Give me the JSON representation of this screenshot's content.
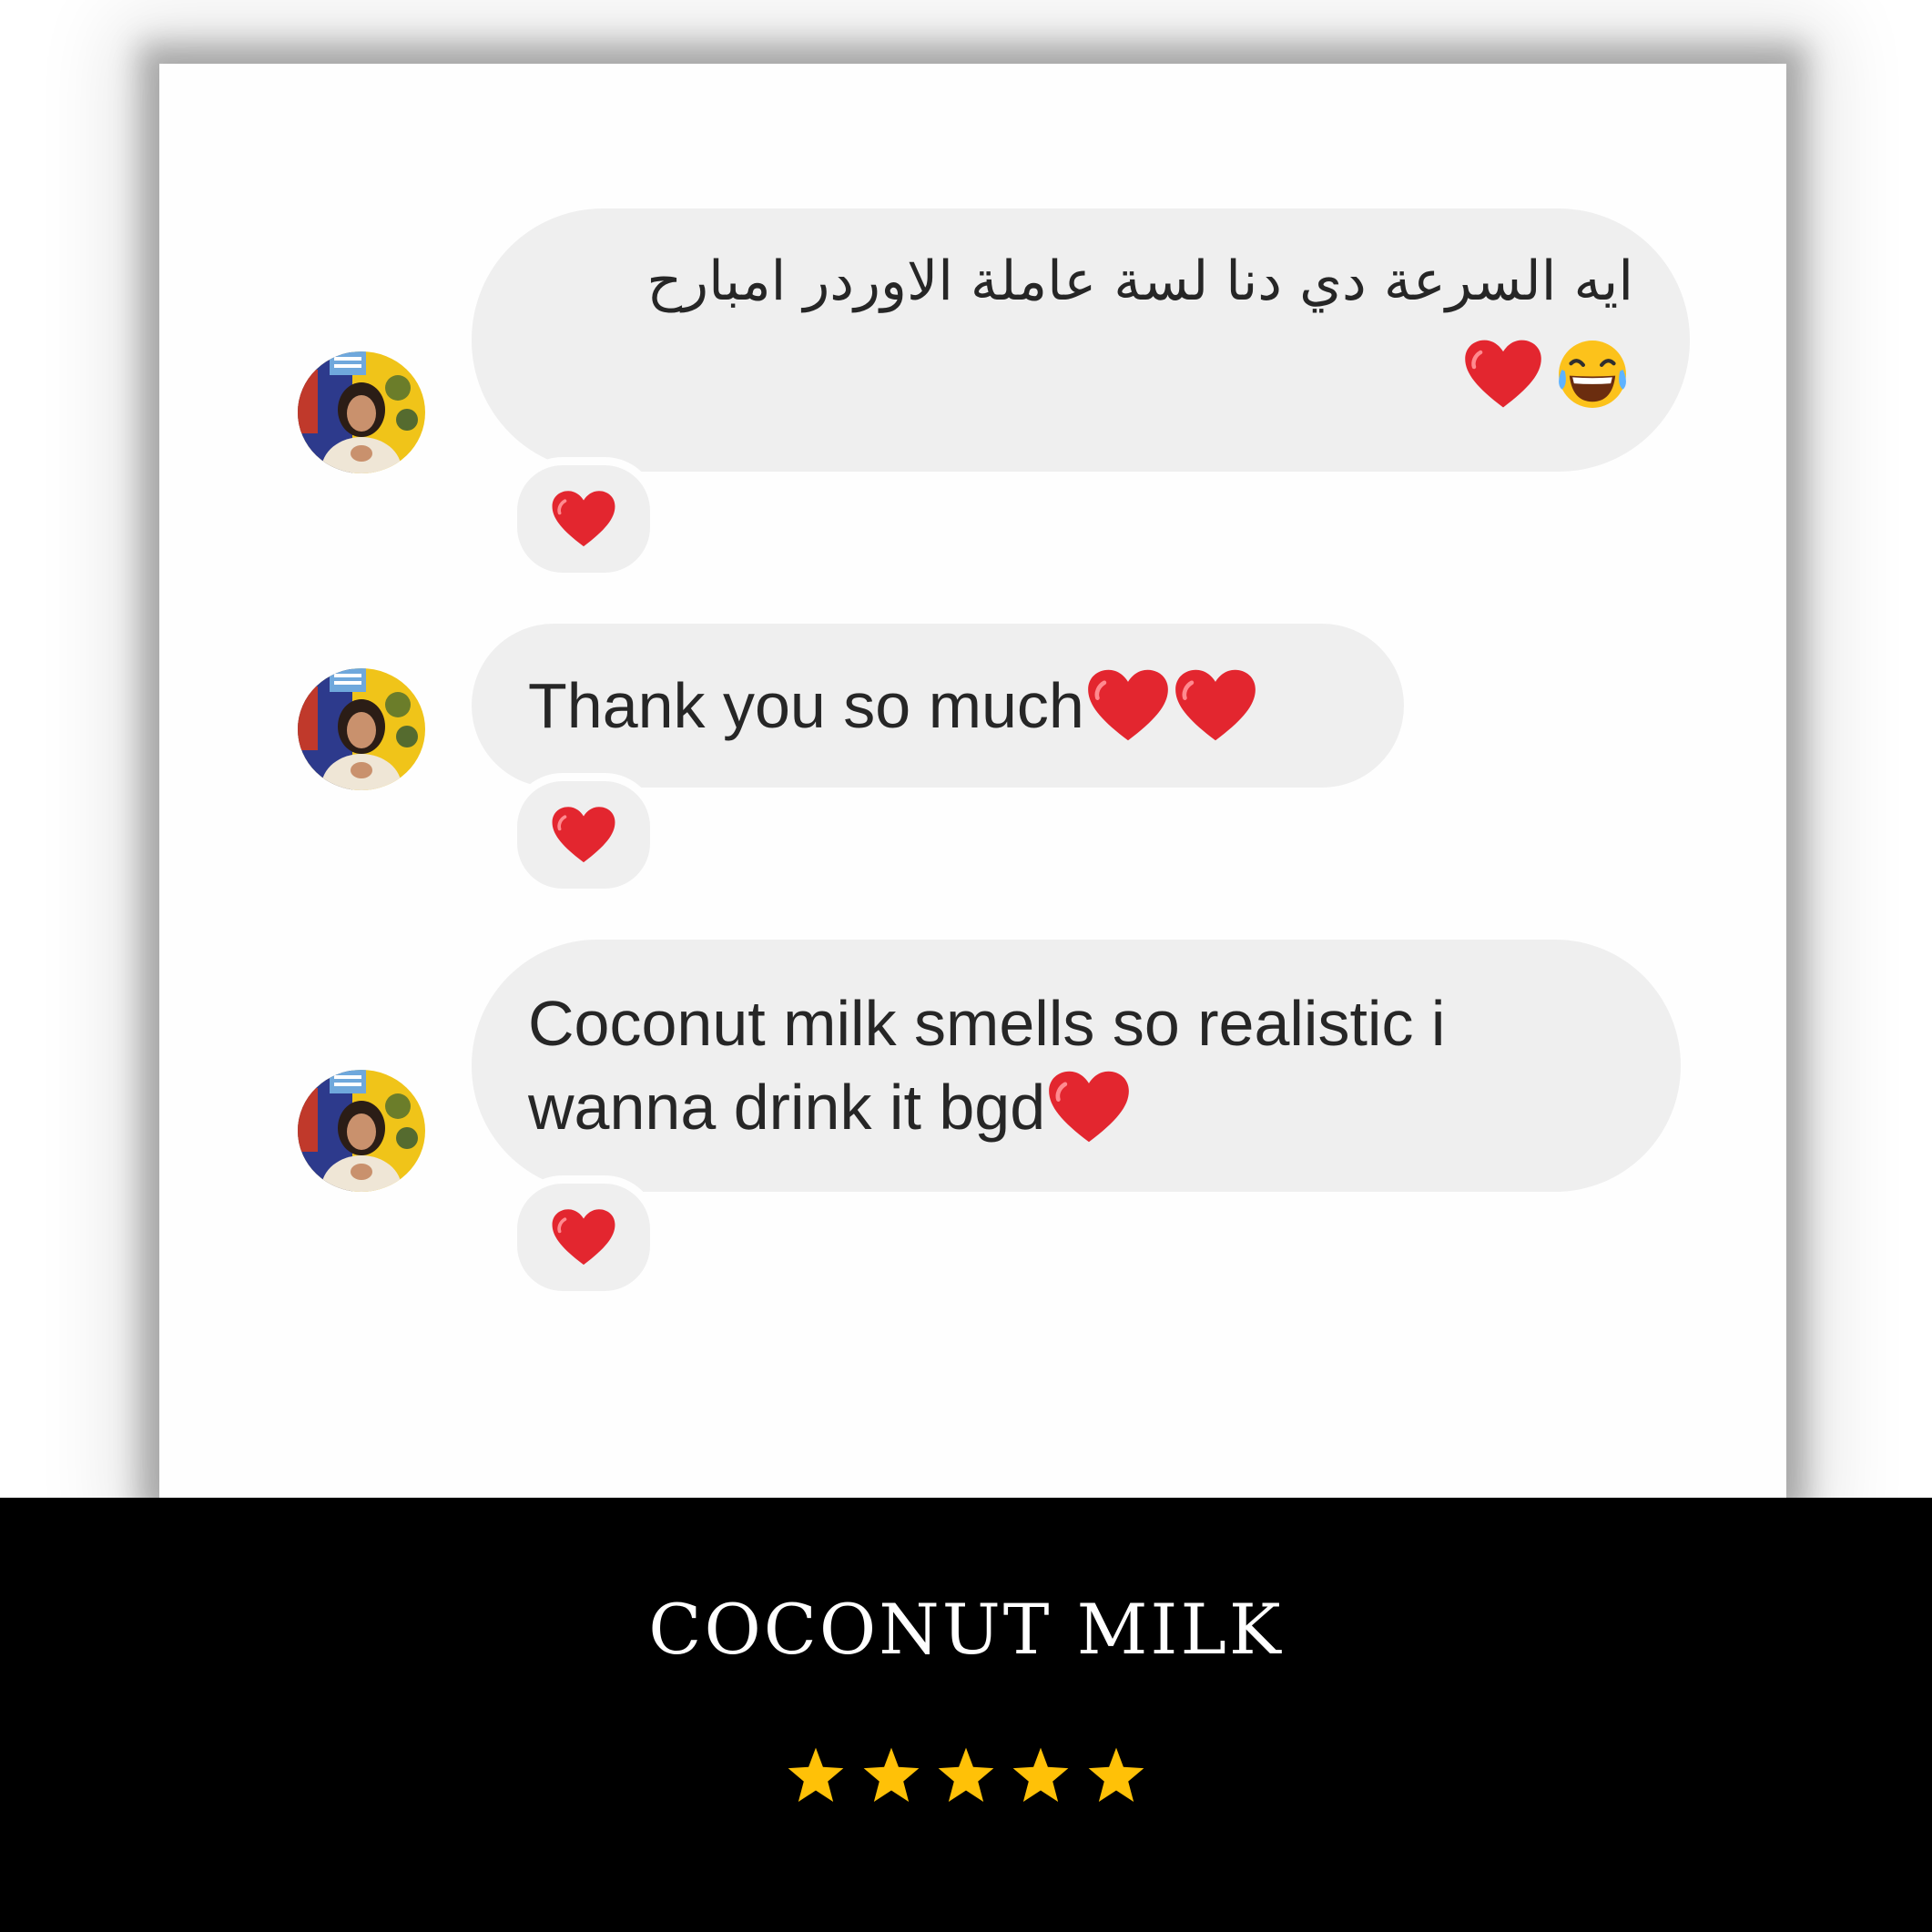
{
  "messages": [
    {
      "text_line1": "ايه السرعة دي دنا لسة عاملة الاوردر امبارح",
      "emojis_line2": [
        "heart-icon",
        "laughing-tears-icon"
      ],
      "reaction": "heart-icon"
    },
    {
      "text": "Thank you so much",
      "emojis": [
        "heart-icon",
        "heart-icon"
      ],
      "reaction": "heart-icon"
    },
    {
      "text_line1": "Coconut milk smells so realistic i",
      "text_line2": "wanna drink it bgd",
      "emojis": [
        "heart-icon"
      ],
      "reaction": "heart-icon"
    }
  ],
  "footer": {
    "product_name": "COCONUT MILK",
    "rating": 5,
    "rating_max": 5
  },
  "colors": {
    "bubble": "#efefef",
    "text": "#262626",
    "heart": "#e3262f",
    "star": "#ffc107",
    "footer_bg": "#000000"
  }
}
